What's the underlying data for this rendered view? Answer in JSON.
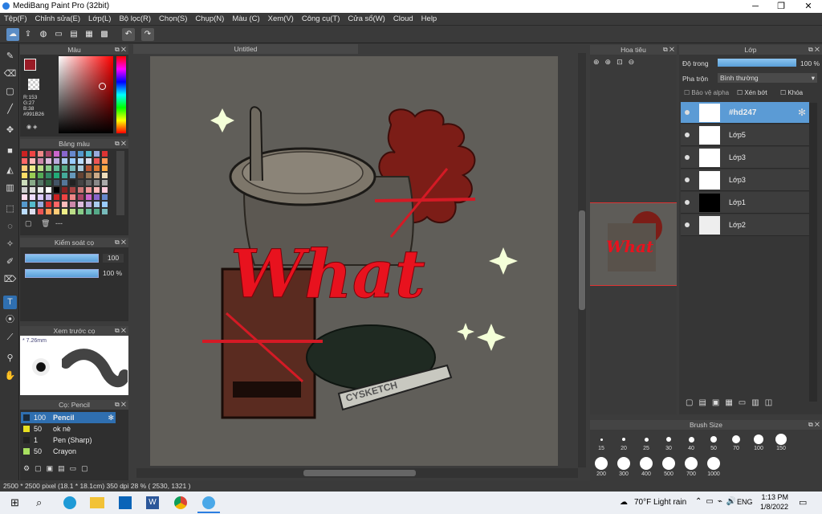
{
  "window": {
    "title": "MediBang Paint Pro (32bit)"
  },
  "menu": [
    "Tệp(F)",
    "Chỉnh sửa(E)",
    "Lớp(L)",
    "Bộ lọc(R)",
    "Chọn(S)",
    "Chụp(N)",
    "Màu (C)",
    "Xem(V)",
    "Công cụ(T)",
    "Cửa sổ(W)",
    "Cloud",
    "Help"
  ],
  "color_panel": {
    "title": "Màu",
    "r": "R:153",
    "g": "G:27",
    "b": "B:38",
    "hex": "#991B26",
    "main_color": "#991b26"
  },
  "swatch_panel": {
    "title": "Bảng màu",
    "dashes": "---"
  },
  "brush_control": {
    "title": "Kiểm soát cọ",
    "size": "100",
    "opacity": "100 %"
  },
  "brush_preview": {
    "title": "Xem trước cọ",
    "size_label": "* 7.26mm"
  },
  "brush_list": {
    "title": "Cọ: Pencil",
    "items": [
      {
        "value": "100",
        "name": "Pencil",
        "color": "#1a2a3a"
      },
      {
        "value": "50",
        "name": "ok nè",
        "color": "#e8e020"
      },
      {
        "value": "1",
        "name": "Pen (Sharp)",
        "color": "#222"
      },
      {
        "value": "50",
        "name": "Crayon",
        "color": "#a8e060"
      }
    ]
  },
  "document": {
    "tab": "Untitled"
  },
  "navigator": {
    "title": "Hoa tiêu"
  },
  "layer_panel": {
    "title": "Lớp",
    "opacity_label": "Độ trong",
    "opacity_value": "100 %",
    "blend_label": "Pha trộn",
    "blend_value": "Bình thường",
    "protect_alpha": "Bảo vệ alpha",
    "clipping": "Xén bớt",
    "lock": "Khóa",
    "layers": [
      {
        "name": "#hd247"
      },
      {
        "name": "Lớp5"
      },
      {
        "name": "Lớp3"
      },
      {
        "name": "Lớp3"
      },
      {
        "name": "Lớp1"
      },
      {
        "name": "Lớp2"
      }
    ]
  },
  "brush_size": {
    "title": "Brush Size",
    "row1": [
      "15",
      "20",
      "25",
      "30",
      "40",
      "50",
      "70",
      "100",
      "150"
    ],
    "row2": [
      "200",
      "300",
      "400",
      "500",
      "700",
      "1000"
    ]
  },
  "status": "2500 * 2500 pixel   (18.1 * 18.1cm)   350 dpi   28 %   ( 2530, 1321 )",
  "artwork": {
    "text": "What",
    "sleeve": "CYSKETCH"
  },
  "taskbar": {
    "weather": "70°F  Light rain",
    "lang": "ENG",
    "time": "1:13 PM",
    "date": "1/8/2022"
  }
}
